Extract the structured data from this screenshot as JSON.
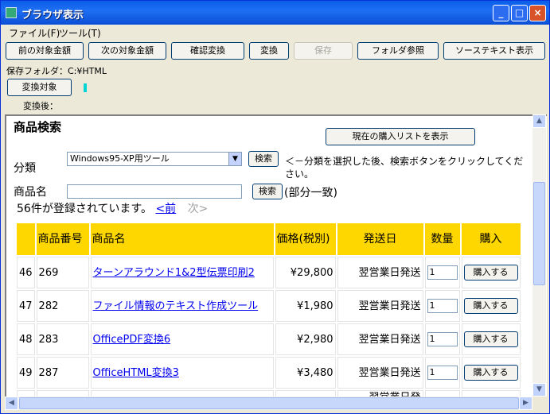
{
  "window": {
    "title": "ブラウザ表示"
  },
  "menu": [
    "ファイル(F)",
    "ツール(T)"
  ],
  "toolbar": {
    "prev_amount": "前の対象金額",
    "next_amount": "次の対象金額",
    "confirm_convert": "確認変換",
    "convert": "変換",
    "save": "保存",
    "folder_browse": "フォルダ参照",
    "source_text": "ソーステキスト表示"
  },
  "save_folder": "保存フォルダ：C:¥HTML",
  "convert_target": "変換対象",
  "after_convert": "変換後：",
  "page": {
    "section_title": "商品検索",
    "show_list": "現在の購入リストを表示",
    "category_label": "分類",
    "category_value": "Windows95-XP用ツール",
    "search1": "検索",
    "hint": "＜－分類を選択した後、検索ボタンをクリックしてください。",
    "name_label": "商品名",
    "search2": "検索",
    "partial": "(部分一致)",
    "count_text": "56件が登録されています。",
    "prev": "<前",
    "next": "次>"
  },
  "table": {
    "headers": [
      "",
      "商品番号",
      "商品名",
      "価格(税別)",
      "発送日",
      "数量",
      "購入"
    ],
    "rows": [
      {
        "idx": "46",
        "code": "269",
        "name": "ターンアラウンド1&2型伝票印刷2",
        "price": "¥29,800",
        "ship": "翌営業日発送",
        "qty": "1",
        "buy": "購入する"
      },
      {
        "idx": "47",
        "code": "282",
        "name": "ファイル情報のテキスト作成ツール",
        "price": "¥1,980",
        "ship": "翌営業日発送",
        "qty": "1",
        "buy": "購入する"
      },
      {
        "idx": "48",
        "code": "283",
        "name": "OfficePDF変換6",
        "price": "¥2,980",
        "ship": "翌営業日発送",
        "qty": "1",
        "buy": "購入する"
      },
      {
        "idx": "49",
        "code": "287",
        "name": "OfficeHTML変換3",
        "price": "¥3,480",
        "ship": "翌営業日発送",
        "qty": "1",
        "buy": "購入する"
      }
    ],
    "partial_ship": "翌営業日発"
  }
}
